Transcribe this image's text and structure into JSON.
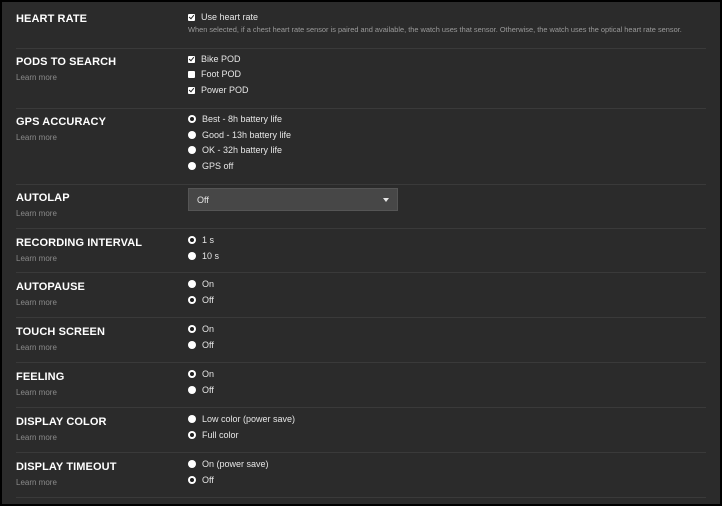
{
  "heart_rate": {
    "title": "HEART RATE",
    "option": "Use heart rate",
    "checked": true,
    "description": "When selected, if a chest heart rate sensor is paired and available, the watch uses that sensor. Otherwise, the watch uses the optical heart rate sensor."
  },
  "pods": {
    "title": "PODS TO SEARCH",
    "learn_more": "Learn more",
    "options": [
      {
        "label": "Bike POD",
        "checked": true
      },
      {
        "label": "Foot POD",
        "checked": false
      },
      {
        "label": "Power POD",
        "checked": true
      }
    ]
  },
  "gps": {
    "title": "GPS ACCURACY",
    "learn_more": "Learn more",
    "options": [
      {
        "label": "Best - 8h battery life",
        "selected": true
      },
      {
        "label": "Good - 13h battery life",
        "selected": false
      },
      {
        "label": "OK - 32h battery life",
        "selected": false
      },
      {
        "label": "GPS off",
        "selected": false
      }
    ]
  },
  "autolap": {
    "title": "AUTOLAP",
    "learn_more": "Learn more",
    "selected_value": "Off"
  },
  "recording_interval": {
    "title": "RECORDING INTERVAL",
    "learn_more": "Learn more",
    "options": [
      {
        "label": "1 s",
        "selected": true
      },
      {
        "label": "10 s",
        "selected": false
      }
    ]
  },
  "autopause": {
    "title": "AUTOPAUSE",
    "learn_more": "Learn more",
    "options": [
      {
        "label": "On",
        "selected": false
      },
      {
        "label": "Off",
        "selected": true
      }
    ]
  },
  "touch_screen": {
    "title": "TOUCH SCREEN",
    "learn_more": "Learn more",
    "options": [
      {
        "label": "On",
        "selected": true
      },
      {
        "label": "Off",
        "selected": false
      }
    ]
  },
  "feeling": {
    "title": "FEELING",
    "learn_more": "Learn more",
    "options": [
      {
        "label": "On",
        "selected": true
      },
      {
        "label": "Off",
        "selected": false
      }
    ]
  },
  "display_color": {
    "title": "DISPLAY COLOR",
    "learn_more": "Learn more",
    "options": [
      {
        "label": "Low color (power save)",
        "selected": false
      },
      {
        "label": "Full color",
        "selected": true
      }
    ]
  },
  "display_timeout": {
    "title": "DISPLAY TIMEOUT",
    "learn_more": "Learn more",
    "options": [
      {
        "label": "On (power save)",
        "selected": false
      },
      {
        "label": "Off",
        "selected": true
      }
    ]
  }
}
